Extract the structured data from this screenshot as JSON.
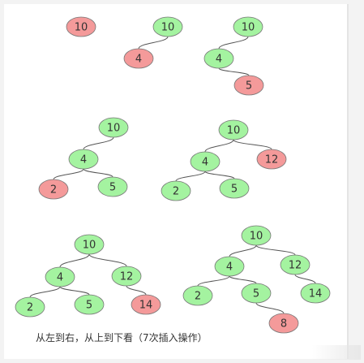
{
  "trees": [
    {
      "name": "step-1",
      "nodes": [
        {
          "id": "a",
          "value": "10",
          "state": "new"
        }
      ],
      "edges": []
    },
    {
      "name": "step-2",
      "nodes": [
        {
          "id": "a",
          "value": "10",
          "state": "normal"
        },
        {
          "id": "b",
          "value": "4",
          "state": "new"
        }
      ],
      "edges": [
        [
          "a",
          "b"
        ]
      ]
    },
    {
      "name": "step-3",
      "nodes": [
        {
          "id": "a",
          "value": "10",
          "state": "normal"
        },
        {
          "id": "b",
          "value": "4",
          "state": "normal"
        },
        {
          "id": "c",
          "value": "5",
          "state": "new"
        }
      ],
      "edges": [
        [
          "a",
          "b"
        ],
        [
          "b",
          "c"
        ]
      ]
    },
    {
      "name": "step-4",
      "nodes": [
        {
          "id": "a",
          "value": "10",
          "state": "normal"
        },
        {
          "id": "b",
          "value": "4",
          "state": "normal"
        },
        {
          "id": "c",
          "value": "2",
          "state": "new"
        },
        {
          "id": "d",
          "value": "5",
          "state": "normal"
        }
      ],
      "edges": [
        [
          "a",
          "b"
        ],
        [
          "b",
          "c"
        ],
        [
          "b",
          "d"
        ]
      ]
    },
    {
      "name": "step-5",
      "nodes": [
        {
          "id": "a",
          "value": "10",
          "state": "normal"
        },
        {
          "id": "b",
          "value": "4",
          "state": "normal"
        },
        {
          "id": "c",
          "value": "12",
          "state": "new"
        },
        {
          "id": "d",
          "value": "2",
          "state": "normal"
        },
        {
          "id": "e",
          "value": "5",
          "state": "normal"
        }
      ],
      "edges": [
        [
          "a",
          "b"
        ],
        [
          "a",
          "c"
        ],
        [
          "b",
          "d"
        ],
        [
          "b",
          "e"
        ]
      ]
    },
    {
      "name": "step-6",
      "nodes": [
        {
          "id": "a",
          "value": "10",
          "state": "normal"
        },
        {
          "id": "b",
          "value": "4",
          "state": "normal"
        },
        {
          "id": "c",
          "value": "12",
          "state": "normal"
        },
        {
          "id": "d",
          "value": "2",
          "state": "normal"
        },
        {
          "id": "e",
          "value": "5",
          "state": "normal"
        },
        {
          "id": "f",
          "value": "14",
          "state": "new"
        }
      ],
      "edges": [
        [
          "a",
          "b"
        ],
        [
          "a",
          "c"
        ],
        [
          "b",
          "d"
        ],
        [
          "b",
          "e"
        ],
        [
          "c",
          "f"
        ]
      ]
    },
    {
      "name": "step-7",
      "nodes": [
        {
          "id": "a",
          "value": "10",
          "state": "normal"
        },
        {
          "id": "b",
          "value": "4",
          "state": "normal"
        },
        {
          "id": "c",
          "value": "12",
          "state": "normal"
        },
        {
          "id": "d",
          "value": "2",
          "state": "normal"
        },
        {
          "id": "e",
          "value": "5",
          "state": "normal"
        },
        {
          "id": "f",
          "value": "14",
          "state": "normal"
        },
        {
          "id": "g",
          "value": "8",
          "state": "new"
        }
      ],
      "edges": [
        [
          "a",
          "b"
        ],
        [
          "a",
          "c"
        ],
        [
          "b",
          "d"
        ],
        [
          "b",
          "e"
        ],
        [
          "c",
          "f"
        ],
        [
          "e",
          "g"
        ]
      ]
    }
  ],
  "caption": "从左到右，从上到下看（7次插入操作）",
  "colors": {
    "new_node": "#f49a9a",
    "normal_node": "#a4f3a0"
  }
}
